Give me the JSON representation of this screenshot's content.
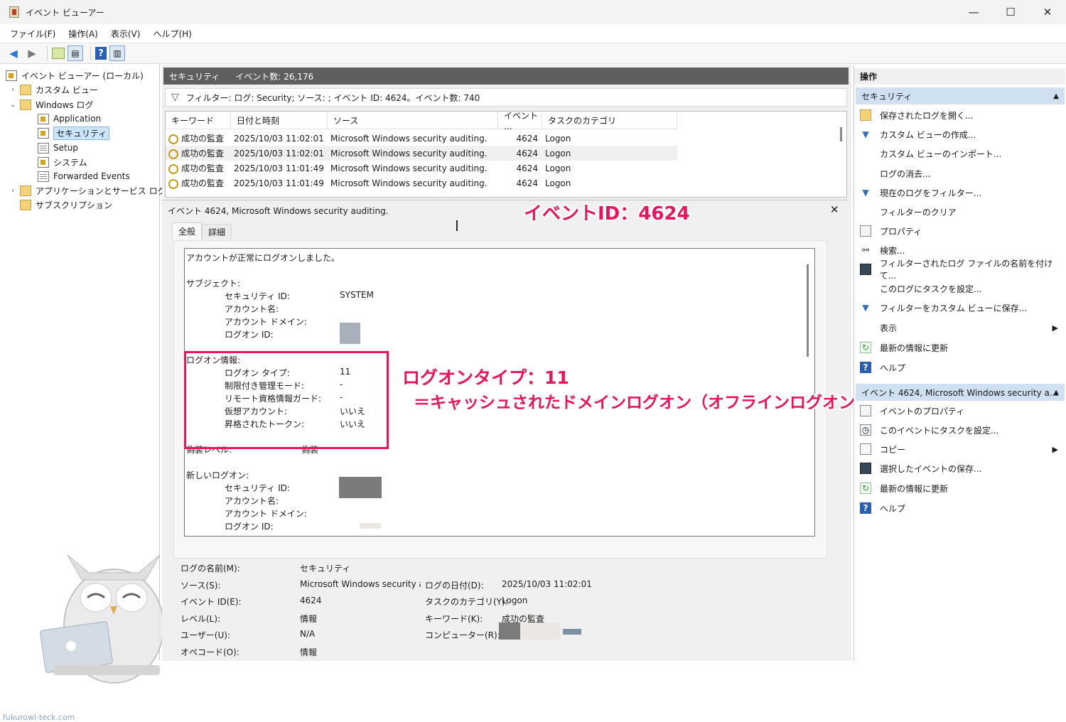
{
  "window": {
    "title": "イベント ビューアー",
    "min": "—",
    "max": "☐",
    "close": "✕"
  },
  "menu": [
    "ファイル(F)",
    "操作(A)",
    "表示(V)",
    "ヘルプ(H)"
  ],
  "tree": {
    "root": "イベント ビューアー (ローカル)",
    "custom_views": "カスタム ビュー",
    "windows_logs": "Windows ログ",
    "application": "Application",
    "security": "セキュリティ",
    "setup": "Setup",
    "system": "システム",
    "forwarded": "Forwarded Events",
    "app_service": "アプリケーションとサービス ログ",
    "subscriptions": "サブスクリプション"
  },
  "watermark": "fukurowl-teck.com",
  "center": {
    "log_name": "セキュリティ",
    "event_count": "イベント数: 26,176",
    "filter_text": "フィルター: ログ: Security; ソース: ; イベント ID: 4624。イベント数: 740",
    "columns": [
      "キーワード",
      "日付と時刻",
      "ソース",
      "イベント ...",
      "タスクのカテゴリ"
    ],
    "rows": [
      {
        "keyword": "成功の監査",
        "date": "2025/10/03 11:02:01",
        "source": "Microsoft Windows security auditing.",
        "event_id": "4624",
        "category": "Logon"
      },
      {
        "keyword": "成功の監査",
        "date": "2025/10/03 11:02:01",
        "source": "Microsoft Windows security auditing.",
        "event_id": "4624",
        "category": "Logon"
      },
      {
        "keyword": "成功の監査",
        "date": "2025/10/03 11:01:49",
        "source": "Microsoft Windows security auditing.",
        "event_id": "4624",
        "category": "Logon"
      },
      {
        "keyword": "成功の監査",
        "date": "2025/10/03 11:01:49",
        "source": "Microsoft Windows security auditing.",
        "event_id": "4624",
        "category": "Logon"
      }
    ]
  },
  "detail": {
    "title": "イベント 4624, Microsoft Windows security auditing.",
    "close": "✕",
    "tabs": [
      "全般",
      "詳細"
    ],
    "description": {
      "intro": "アカウントが正常にログオンしました。",
      "subject_header": "サブジェクト:",
      "subject_security_id_label": "セキュリティ ID:",
      "subject_security_id_value": "SYSTEM",
      "subject_account_name_label": "アカウント名:",
      "subject_account_domain_label": "アカウント ドメイン:",
      "subject_logon_id_label": "ログオン ID:",
      "logon_info_header": "ログオン情報:",
      "logon_type_label": "ログオン タイプ:",
      "logon_type_value": "11",
      "restricted_admin_label": "制限付き管理モード:",
      "restricted_admin_value": "-",
      "remote_cred_label": "リモート資格情報ガード:",
      "remote_cred_value": "-",
      "virtual_account_label": "仮想アカウント:",
      "virtual_account_value": "いいえ",
      "elevated_token_label": "昇格されたトークン:",
      "elevated_token_value": "いいえ",
      "impersonation_label": "偽装レベル:",
      "impersonation_value": "偽装",
      "new_logon_header": "新しいログオン:",
      "new_security_id_label": "セキュリティ ID:",
      "new_account_name_label": "アカウント名:",
      "new_account_domain_label": "アカウント ドメイン:",
      "new_logon_id_label": "ログオン ID:"
    },
    "props": {
      "log_name_label": "ログの名前(M):",
      "log_name_value": "セキュリティ",
      "source_label": "ソース(S):",
      "source_value": "Microsoft Windows security auc",
      "logged_label": "ログの日付(D):",
      "logged_value": "2025/10/03 11:02:01",
      "event_id_label": "イベント ID(E):",
      "event_id_value": "4624",
      "task_cat_label": "タスクのカテゴリ(Y):",
      "task_cat_value": "Logon",
      "level_label": "レベル(L):",
      "level_value": "情報",
      "keywords_label": "キーワード(K):",
      "keywords_value": "成功の監査",
      "user_label": "ユーザー(U):",
      "user_value": "N/A",
      "computer_label": "コンピューター(R):",
      "opcode_label": "オペコード(O):",
      "opcode_value": "情報"
    }
  },
  "annotations": {
    "event_id": "イベントID：4624",
    "logon_type": "ログオンタイプ：11",
    "logon_type_desc": "＝キャッシュされたドメインログオン（オフラインログオン）"
  },
  "actions": {
    "header": "操作",
    "section1": "セキュリティ",
    "section1_items": [
      {
        "label": "保存されたログを開く...",
        "icon": "folder-open-icon"
      },
      {
        "label": "カスタム ビューの作成...",
        "icon": "funnel-create-icon"
      },
      {
        "label": "カスタム ビューのインポート...",
        "icon": ""
      },
      {
        "label": "ログの消去...",
        "icon": ""
      },
      {
        "label": "現在のログをフィルター...",
        "icon": "funnel-icon"
      },
      {
        "label": "フィルターのクリア",
        "icon": ""
      },
      {
        "label": "プロパティ",
        "icon": "properties-icon"
      },
      {
        "label": "検索...",
        "icon": "binoculars-icon"
      },
      {
        "label": "フィルターされたログ ファイルの名前を付けて...",
        "icon": "save-icon"
      },
      {
        "label": "このログにタスクを設定...",
        "icon": ""
      },
      {
        "label": "フィルターをカスタム ビューに保存...",
        "icon": "funnel-save-icon"
      },
      {
        "label": "表示",
        "icon": ""
      },
      {
        "label": "最新の情報に更新",
        "icon": "refresh-icon"
      },
      {
        "label": "ヘルプ",
        "icon": "help-icon"
      }
    ],
    "section2": "イベント 4624, Microsoft Windows security a...",
    "section2_items": [
      {
        "label": "イベントのプロパティ",
        "icon": "event-properties-icon"
      },
      {
        "label": "このイベントにタスクを設定...",
        "icon": "task-icon"
      },
      {
        "label": "コピー",
        "icon": "copy-icon"
      },
      {
        "label": "選択したイベントの保存...",
        "icon": "save-icon"
      },
      {
        "label": "最新の情報に更新",
        "icon": "refresh-icon"
      },
      {
        "label": "ヘルプ",
        "icon": "help-icon"
      }
    ]
  },
  "colors": {
    "accent": "#e8155e",
    "header_bg": "#5f5f5f",
    "section_bg": "#cfe0f1"
  }
}
